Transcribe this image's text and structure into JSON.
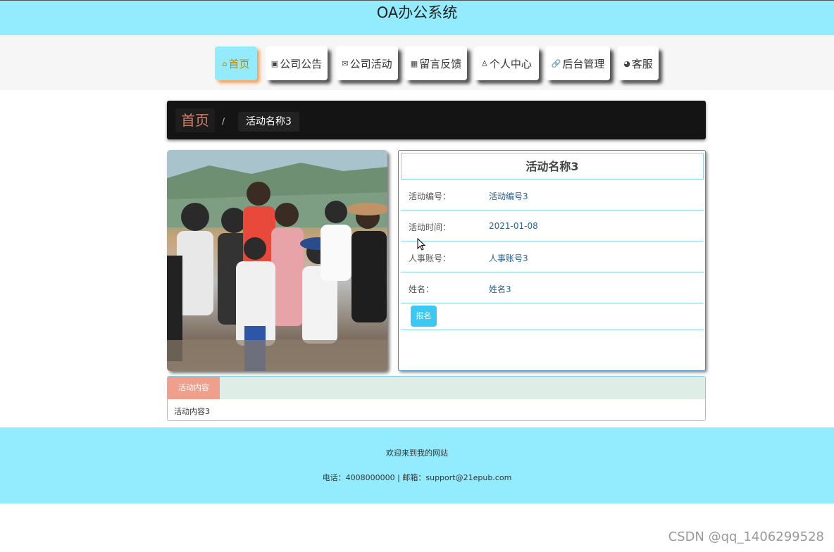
{
  "app": {
    "title": "OA办公系统"
  },
  "nav": {
    "items": [
      {
        "label": "首页",
        "icon": "home-icon",
        "glyph": "⌂",
        "active": true
      },
      {
        "label": "公司公告",
        "icon": "gift-icon",
        "glyph": "▣",
        "active": false
      },
      {
        "label": "公司活动",
        "icon": "envelope-icon",
        "glyph": "✉",
        "active": false
      },
      {
        "label": "留言反馈",
        "icon": "calendar-icon",
        "glyph": "▦",
        "active": false
      },
      {
        "label": "个人中心",
        "icon": "user-icon",
        "glyph": "♙",
        "active": false
      },
      {
        "label": "后台管理",
        "icon": "link-icon",
        "glyph": "🔗",
        "active": false
      },
      {
        "label": "客服",
        "icon": "support-icon",
        "glyph": "◕",
        "active": false
      }
    ]
  },
  "breadcrumb": {
    "home": "首页",
    "separator": "/",
    "current": "活动名称3"
  },
  "detail": {
    "title": "活动名称3",
    "fields": [
      {
        "label": "活动编号：",
        "value": "活动编号3"
      },
      {
        "label": "活动时间：",
        "value": "2021-01-08"
      },
      {
        "label": "人事账号：",
        "value": "人事账号3"
      },
      {
        "label": "姓名：",
        "value": "姓名3"
      }
    ],
    "signup_label": "报名"
  },
  "content": {
    "tab_label": "活动内容",
    "text": "活动内容3"
  },
  "footer": {
    "welcome": "欢迎来到我的网站",
    "contact": "电话：4008000000 | 邮箱：support@21epub.com"
  },
  "watermark": "CSDN @qq_1406299528",
  "colors": {
    "header_bg": "#93ecfd",
    "accent_btn": "#3cc8f4",
    "tab_active": "#eea08d"
  }
}
